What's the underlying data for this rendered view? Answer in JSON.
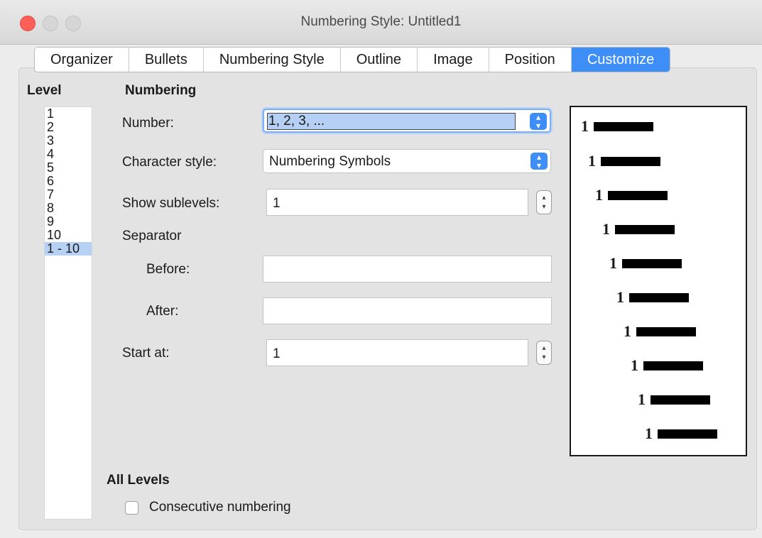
{
  "window": {
    "title": "Numbering Style: Untitled1"
  },
  "tabs": [
    "Organizer",
    "Bullets",
    "Numbering Style",
    "Outline",
    "Image",
    "Position",
    "Customize"
  ],
  "active_tab": "Customize",
  "level": {
    "heading": "Level",
    "items": [
      "1",
      "2",
      "3",
      "4",
      "5",
      "6",
      "7",
      "8",
      "9",
      "10",
      "1 - 10"
    ],
    "selected": "1 - 10"
  },
  "numbering": {
    "heading": "Numbering",
    "number_label": "Number:",
    "number_value": "1, 2, 3, ...",
    "char_style_label": "Character style:",
    "char_style_value": "Numbering Symbols",
    "sublevels_label": "Show sublevels:",
    "sublevels_value": "1",
    "separator_label": "Separator",
    "before_label": "Before:",
    "before_value": "",
    "after_label": "After:",
    "after_value": "",
    "start_label": "Start at:",
    "start_value": "1"
  },
  "preview": {
    "numbers": [
      "1",
      "1",
      "1",
      "1",
      "1",
      "1",
      "1",
      "1",
      "1",
      "1"
    ]
  },
  "all_levels": {
    "heading": "All Levels",
    "consecutive_label": "Consecutive numbering",
    "consecutive_checked": false
  },
  "icons": {
    "combo_arrow": "chevron-up-down-icon",
    "spinner": "stepper-up-down-icon"
  },
  "colors": {
    "accent": "#3d8ff7",
    "close": "#fc5f57",
    "selection": "#b7d1f5"
  }
}
